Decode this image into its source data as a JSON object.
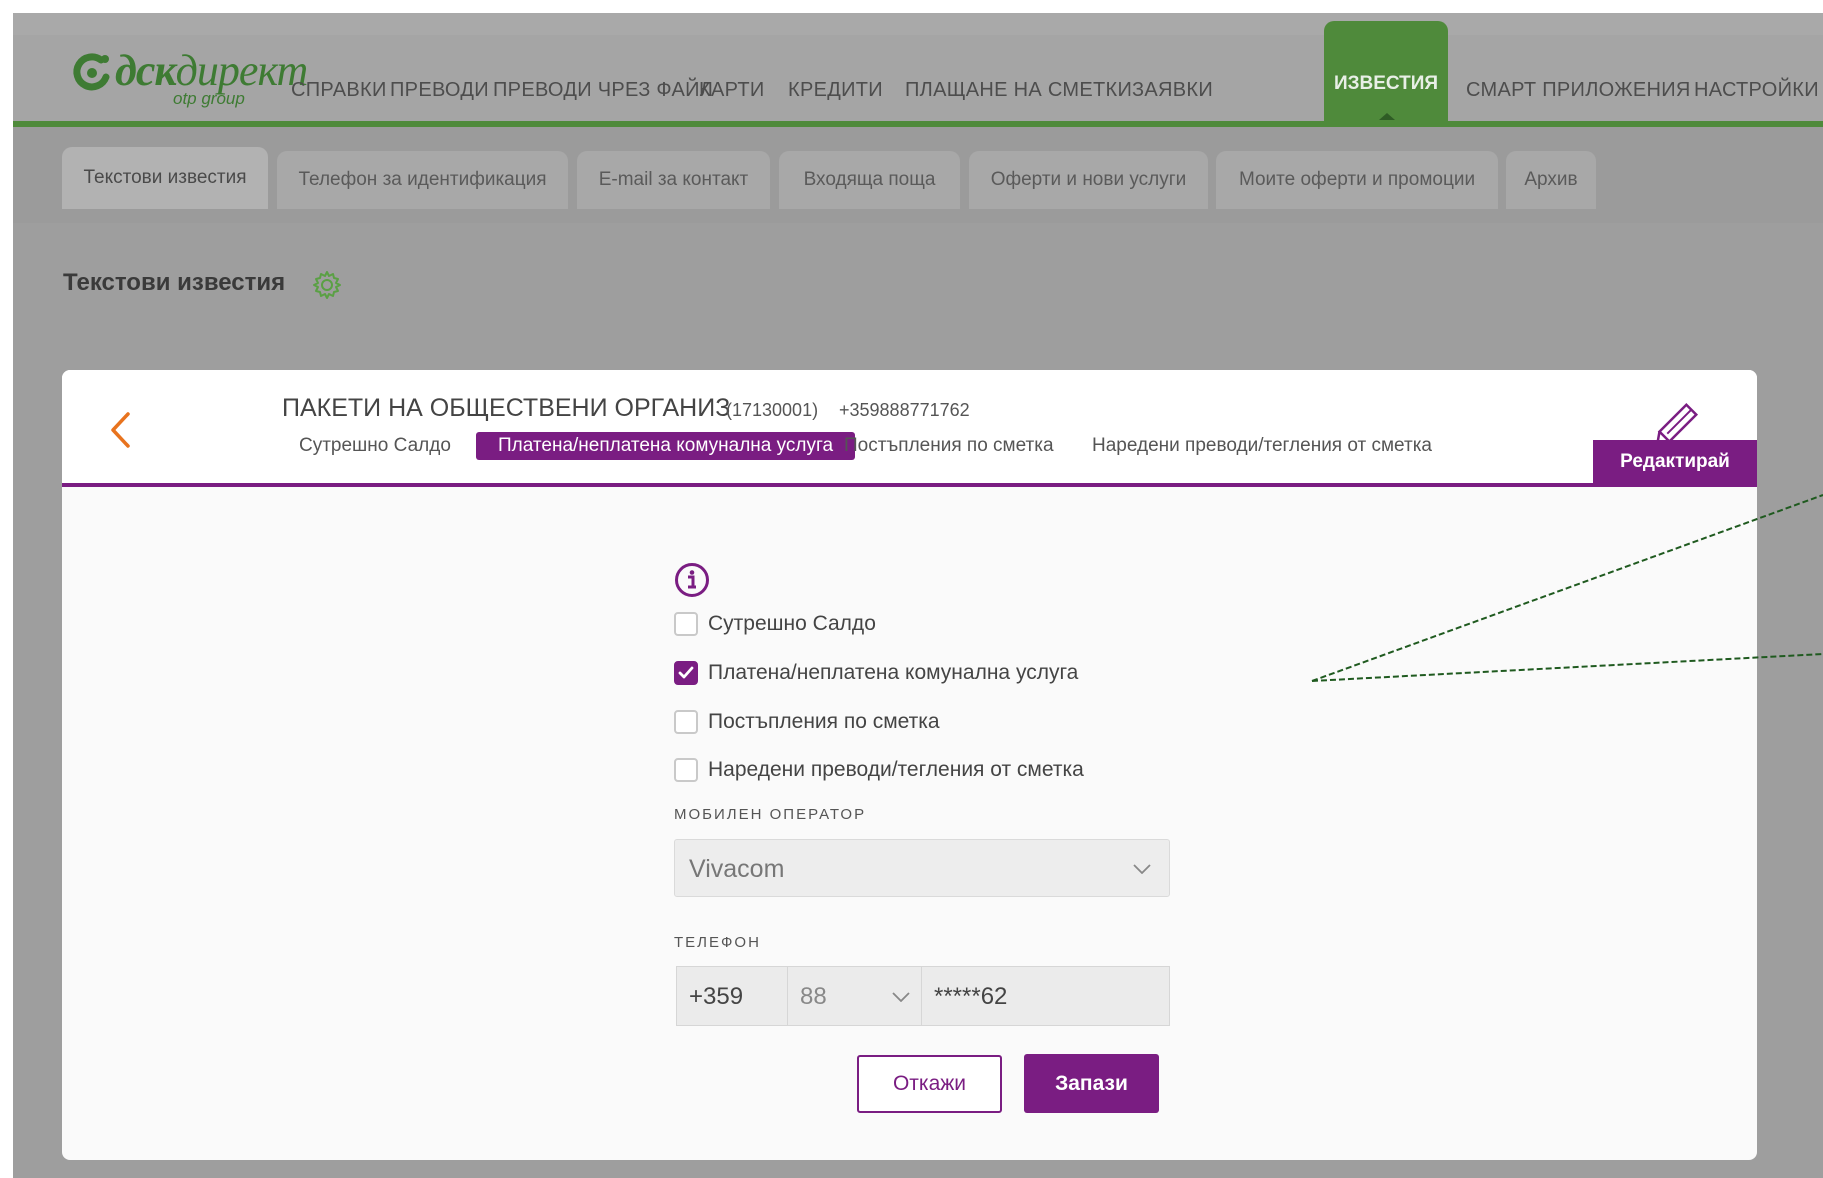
{
  "logo": {
    "name_bold": "дск",
    "name_rest": "директ",
    "sub": "otp group"
  },
  "nav": {
    "items": [
      "СПРАВКИ",
      "ПРЕВОДИ",
      "ПРЕВОДИ ЧРЕЗ ФАЙЛ",
      "КАРТИ",
      "КРЕДИТИ",
      "ПЛАЩАНЕ НА СМЕТКИ",
      "ЗАЯВКИ"
    ],
    "active": "ИЗВЕСТИЯ",
    "items_after": [
      "СМАРТ ПРИЛОЖЕНИЯ",
      "НАСТРОЙКИ"
    ]
  },
  "subtabs": [
    "Текстови известия",
    "Телефон за идентификация",
    "E-mail за контакт",
    "Входяща поща",
    "Оферти и нови услуги",
    "Моите оферти и промоции",
    "Архив"
  ],
  "section": {
    "title": "Текстови известия"
  },
  "card": {
    "account_name": "ПАКЕТИ НА ОБЩЕСТВЕНИ ОРГАНИЗ",
    "account_number": "(17130001)",
    "phone": "+359888771762",
    "tabs": [
      "Сутрешно Салдо",
      "Платена/неплатена комунална услуга",
      "Постъпления по сметка",
      "Наредени преводи/тегления от сметка"
    ],
    "active_tab": 1,
    "edit_label": "Редактирай"
  },
  "form": {
    "options": [
      {
        "label": "Сутрешно Салдо",
        "checked": false
      },
      {
        "label": "Платена/неплатена комунална услуга",
        "checked": true
      },
      {
        "label": "Постъпления по сметка",
        "checked": false
      },
      {
        "label": "Наредени преводи/тегления от сметка",
        "checked": false
      }
    ],
    "operator_label": "МОБИЛЕН ОПЕРАТОР",
    "operator_value": "Vivacom",
    "phone_label": "ТЕЛЕФОН",
    "phone_country_code": "+359",
    "phone_operator_code": "88",
    "phone_number": "*****62",
    "cancel_label": "Откажи",
    "save_label": "Запази"
  },
  "colors": {
    "brand_green": "#4f8a3b",
    "accent_purple": "#7a1d82",
    "back_orange": "#e8731e"
  }
}
